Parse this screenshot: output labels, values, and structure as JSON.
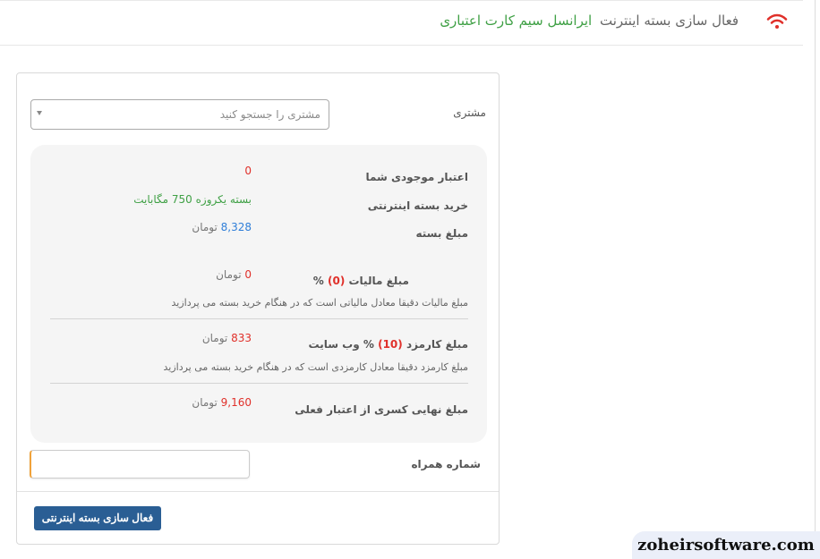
{
  "header": {
    "title": "فعال سازی بسته اینترنت",
    "subtitle": "ایرانسل سیم کارت اعتباری",
    "icon": "wifi-icon",
    "icon_color": "#e0302a"
  },
  "form": {
    "customer_label": "مشتری",
    "customer_placeholder": "مشتری را جستجو کنید",
    "phone_label": "شماره همراه",
    "phone_value": "",
    "submit_label": "فعال سازی بسته اینترنتی"
  },
  "summary": {
    "balance_label": "اعتبار موجودی شما",
    "balance_value": "0",
    "package_label": "خرید بسته اینترنتی",
    "package_value": "بسته یکروزه 750 مگابایت",
    "price_label": "مبلغ بسته",
    "price_value": "8,328",
    "price_unit": "تومان",
    "tax_label_prefix": "مبلغ مالیات",
    "tax_percent": "(0)",
    "tax_label_suffix": "%",
    "tax_value": "0",
    "tax_unit": "تومان",
    "tax_note": "مبلغ مالیات دقیقا معادل مالیاتی است که در هنگام خرید بسته می پردازید",
    "fee_label_prefix": "مبلغ کارمزد",
    "fee_percent": "(10)",
    "fee_label_suffix": "% وب سایت",
    "fee_value": "833",
    "fee_unit": "تومان",
    "fee_note": "مبلغ کارمزد دقیقا معادل کارمزدی است که در هنگام خرید بسته می پردازید",
    "total_label": "مبلغ نهایی کسری از اعتبار فعلی",
    "total_value": "9,160",
    "total_unit": "تومان"
  },
  "watermark": "zoheirsoftware.com",
  "colors": {
    "accent_green": "#3fa045",
    "accent_red": "#e0302a",
    "accent_blue": "#2f7ed8",
    "button": "#2a5e94"
  }
}
